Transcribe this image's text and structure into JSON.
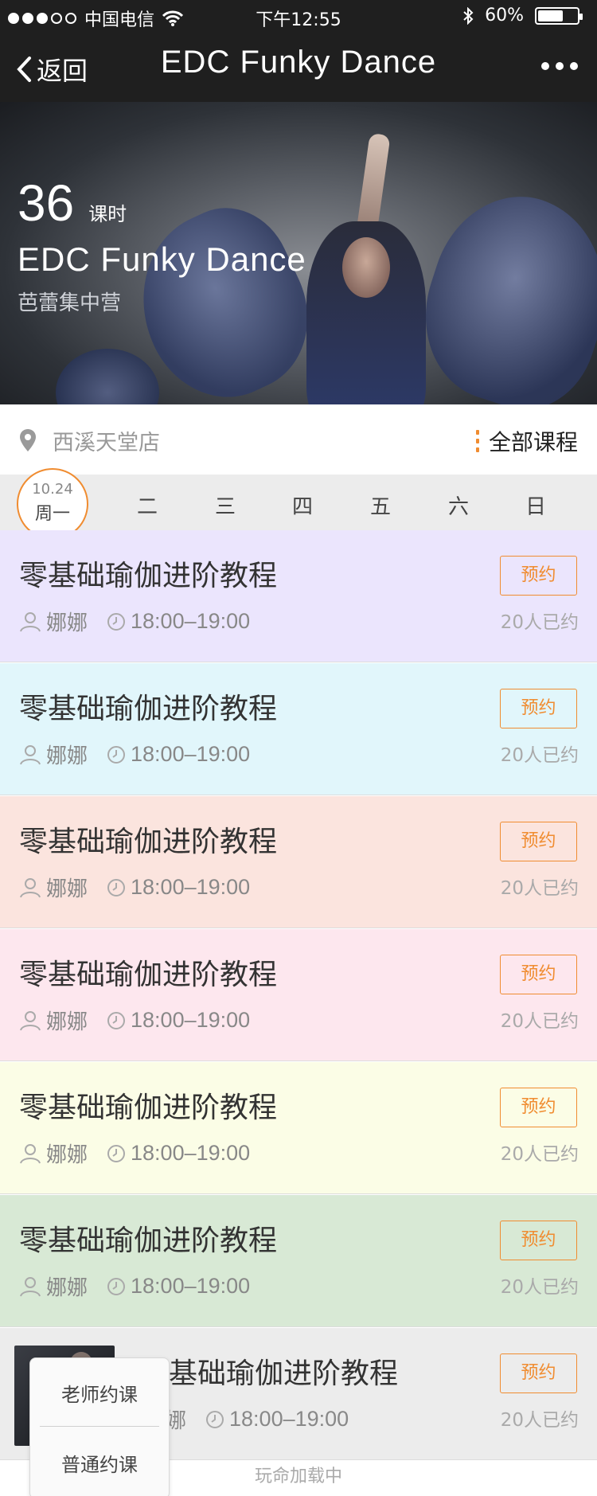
{
  "status_bar": {
    "carrier": "中国电信",
    "time": "下午12:55",
    "battery": "60%"
  },
  "nav": {
    "back_label": "返回",
    "title": "EDC Funky Dance"
  },
  "hero": {
    "hours": "36",
    "hours_unit": "课时",
    "course_name": "EDC Funky Dance",
    "subtitle": "芭蕾集中营"
  },
  "location": {
    "store": "西溪天堂店",
    "all_courses_label": "全部课程"
  },
  "week": {
    "today_date": "10.24",
    "today_label": "周一",
    "days": [
      "二",
      "三",
      "四",
      "五",
      "六",
      "日"
    ]
  },
  "courses": [
    {
      "title": "零基础瑜伽进阶教程",
      "teacher": "娜娜",
      "time": "18:00–19:00",
      "book_label": "预约",
      "booked": "20人已约",
      "bg": "#ebe5fd"
    },
    {
      "title": "零基础瑜伽进阶教程",
      "teacher": "娜娜",
      "time": "18:00–19:00",
      "book_label": "预约",
      "booked": "20人已约",
      "bg": "#e1f6fb"
    },
    {
      "title": "零基础瑜伽进阶教程",
      "teacher": "娜娜",
      "time": "18:00–19:00",
      "book_label": "预约",
      "booked": "20人已约",
      "bg": "#fbe4de"
    },
    {
      "title": "零基础瑜伽进阶教程",
      "teacher": "娜娜",
      "time": "18:00–19:00",
      "book_label": "预约",
      "booked": "20人已约",
      "bg": "#fde7ee"
    },
    {
      "title": "零基础瑜伽进阶教程",
      "teacher": "娜娜",
      "time": "18:00–19:00",
      "book_label": "预约",
      "booked": "20人已约",
      "bg": "#fbfde6"
    },
    {
      "title": "零基础瑜伽进阶教程",
      "teacher": "娜娜",
      "time": "18:00–19:00",
      "book_label": "预约",
      "booked": "20人已约",
      "bg": "#d8e9d5"
    },
    {
      "title": "零基础瑜伽进阶教程",
      "teacher": "娜娜",
      "time": "18:00–19:00",
      "book_label": "预约",
      "booked": "20人已约",
      "bg": "#ececec"
    }
  ],
  "loading_text": "玩命加载中",
  "popup": {
    "teacher_booking": "老师约课",
    "normal_booking": "普通约课"
  },
  "colors": {
    "accent": "#f08c30",
    "bar": "#1f1f1f"
  }
}
